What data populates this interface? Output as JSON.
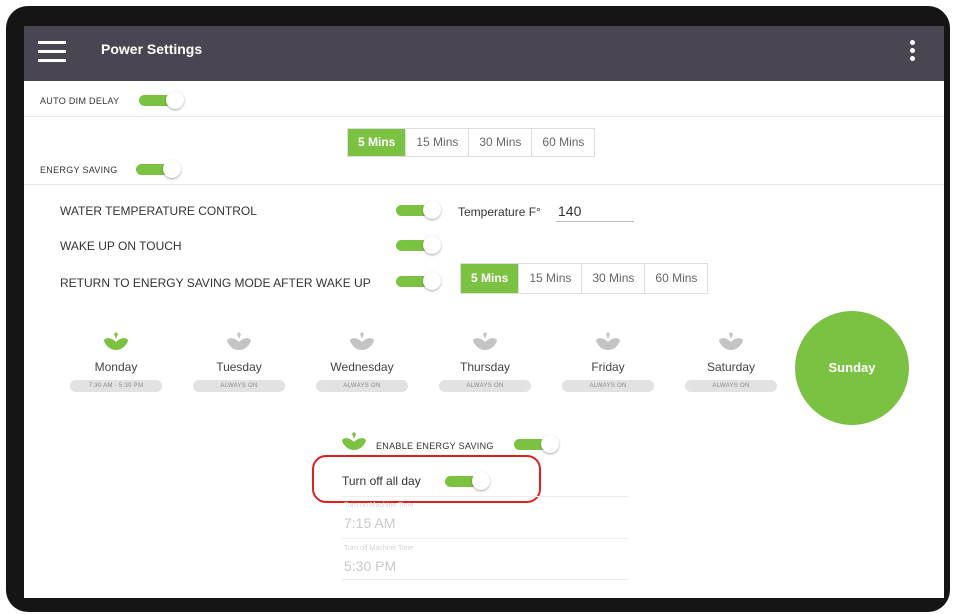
{
  "header": {
    "title": "Power Settings",
    "menu_icon": "hamburger-icon",
    "more_icon": "kebab-icon"
  },
  "auto_dim": {
    "label": "AUTO DIM DELAY",
    "enabled": true,
    "options": [
      "5 Mins",
      "15 Mins",
      "30 Mins",
      "60 Mins"
    ],
    "selected": "5 Mins"
  },
  "energy_saving": {
    "label": "ENERGY SAVING",
    "enabled": true
  },
  "water_temp": {
    "label": "WATER TEMPERATURE CONTROL",
    "enabled": true,
    "temperature_label": "Temperature F°",
    "temperature_value": "140"
  },
  "wake_up": {
    "label": "WAKE UP ON TOUCH",
    "enabled": true
  },
  "return_mode": {
    "label": "RETURN TO ENERGY SAVING MODE AFTER WAKE UP",
    "enabled": true,
    "options": [
      "5 Mins",
      "15 Mins",
      "30 Mins",
      "60 Mins"
    ],
    "selected": "5 Mins"
  },
  "days": [
    {
      "name": "Monday",
      "status": "7:30 AM - 5:30 PM",
      "active": true
    },
    {
      "name": "Tuesday",
      "status": "ALWAYS ON",
      "active": false
    },
    {
      "name": "Wednesday",
      "status": "ALWAYS ON",
      "active": false
    },
    {
      "name": "Thursday",
      "status": "ALWAYS ON",
      "active": false
    },
    {
      "name": "Friday",
      "status": "ALWAYS ON",
      "active": false
    },
    {
      "name": "Saturday",
      "status": "ALWAYS ON",
      "active": false
    }
  ],
  "selected_day": "Sunday",
  "enable_energy_saving": {
    "label": "ENABLE ENERGY SAVING",
    "enabled": true
  },
  "turn_off_all_day": {
    "label": "Turn off all day",
    "enabled": true
  },
  "schedule": {
    "on_time_label": "Turn on Machine Time",
    "on_time": "7:15 AM",
    "off_time_label": "Turn off Machine Time",
    "off_time": "5:30 PM"
  },
  "colors": {
    "accent": "#7cc242",
    "header_bg": "#4a4651",
    "highlight": "#e02020",
    "leaf_inactive": "#c4c4c4"
  }
}
